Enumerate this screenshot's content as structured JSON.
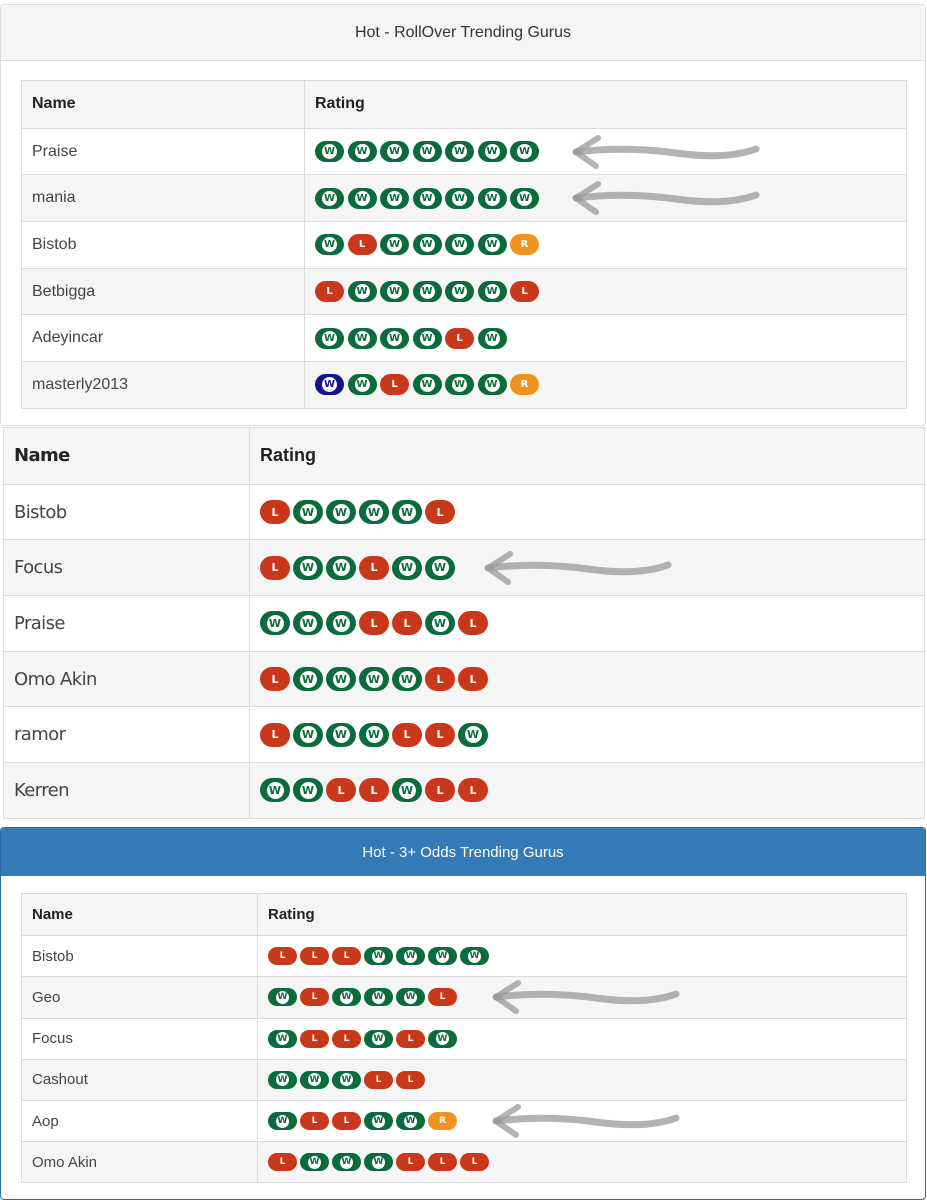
{
  "panel1": {
    "title": "Hot - RollOver Trending Gurus",
    "columns": {
      "name": "Name",
      "rating": "Rating"
    },
    "rows": [
      {
        "name": "Praise",
        "results": [
          "W",
          "W",
          "W",
          "W",
          "W",
          "W",
          "W"
        ],
        "highlighted": true
      },
      {
        "name": "mania",
        "results": [
          "W",
          "W",
          "W",
          "W",
          "W",
          "W",
          "W"
        ],
        "highlighted": true
      },
      {
        "name": "Bistob",
        "results": [
          "W",
          "L",
          "W",
          "W",
          "W",
          "W",
          "R"
        ]
      },
      {
        "name": "Betbigga",
        "results": [
          "L",
          "W",
          "W",
          "W",
          "W",
          "W",
          "L"
        ]
      },
      {
        "name": "Adeyincar",
        "results": [
          "W",
          "W",
          "W",
          "W",
          "L",
          "W"
        ]
      },
      {
        "name": "masterly2013",
        "results": [
          "Wb",
          "W",
          "L",
          "W",
          "W",
          "W",
          "R"
        ]
      }
    ]
  },
  "panel2": {
    "columns": {
      "name": "Name",
      "rating": "Rating"
    },
    "rows": [
      {
        "name": "Bistob",
        "results": [
          "L",
          "W",
          "W",
          "W",
          "W",
          "L"
        ]
      },
      {
        "name": "Focus",
        "results": [
          "L",
          "W",
          "W",
          "L",
          "W",
          "W"
        ],
        "highlighted": true
      },
      {
        "name": "Praise",
        "results": [
          "W",
          "W",
          "W",
          "L",
          "L",
          "W",
          "L"
        ]
      },
      {
        "name": "Omo Akin",
        "results": [
          "L",
          "W",
          "W",
          "W",
          "W",
          "L",
          "L"
        ]
      },
      {
        "name": "ramor",
        "results": [
          "L",
          "W",
          "W",
          "W",
          "L",
          "L",
          "W"
        ]
      },
      {
        "name": "Kerren",
        "results": [
          "W",
          "W",
          "L",
          "L",
          "W",
          "L",
          "L"
        ]
      }
    ]
  },
  "panel3": {
    "title": "Hot - 3+ Odds Trending Gurus",
    "columns": {
      "name": "Name",
      "rating": "Rating"
    },
    "rows": [
      {
        "name": "Bistob",
        "results": [
          "L",
          "L",
          "L",
          "W",
          "W",
          "W",
          "W"
        ]
      },
      {
        "name": "Geo",
        "results": [
          "W",
          "L",
          "W",
          "W",
          "W",
          "L"
        ],
        "highlighted": true
      },
      {
        "name": "Focus",
        "results": [
          "W",
          "L",
          "L",
          "W",
          "L",
          "W"
        ]
      },
      {
        "name": "Cashout",
        "results": [
          "W",
          "W",
          "W",
          "L",
          "L"
        ]
      },
      {
        "name": "Aop",
        "results": [
          "W",
          "L",
          "L",
          "W",
          "W",
          "R"
        ],
        "highlighted": true
      },
      {
        "name": "Omo Akin",
        "results": [
          "L",
          "W",
          "W",
          "W",
          "L",
          "L",
          "L"
        ]
      }
    ]
  },
  "badge_labels": {
    "W": "W",
    "Wb": "W",
    "L": "L",
    "R": "R"
  },
  "colors": {
    "win": "#0c6b3a",
    "win_alt": "#14148a",
    "loss": "#c9381a",
    "refund": "#f0931e",
    "primary_header": "#337ab7",
    "table_stripe": "#f5f5f5",
    "annotation_arrow": "#9a9a9a"
  },
  "annotation": "arrow"
}
